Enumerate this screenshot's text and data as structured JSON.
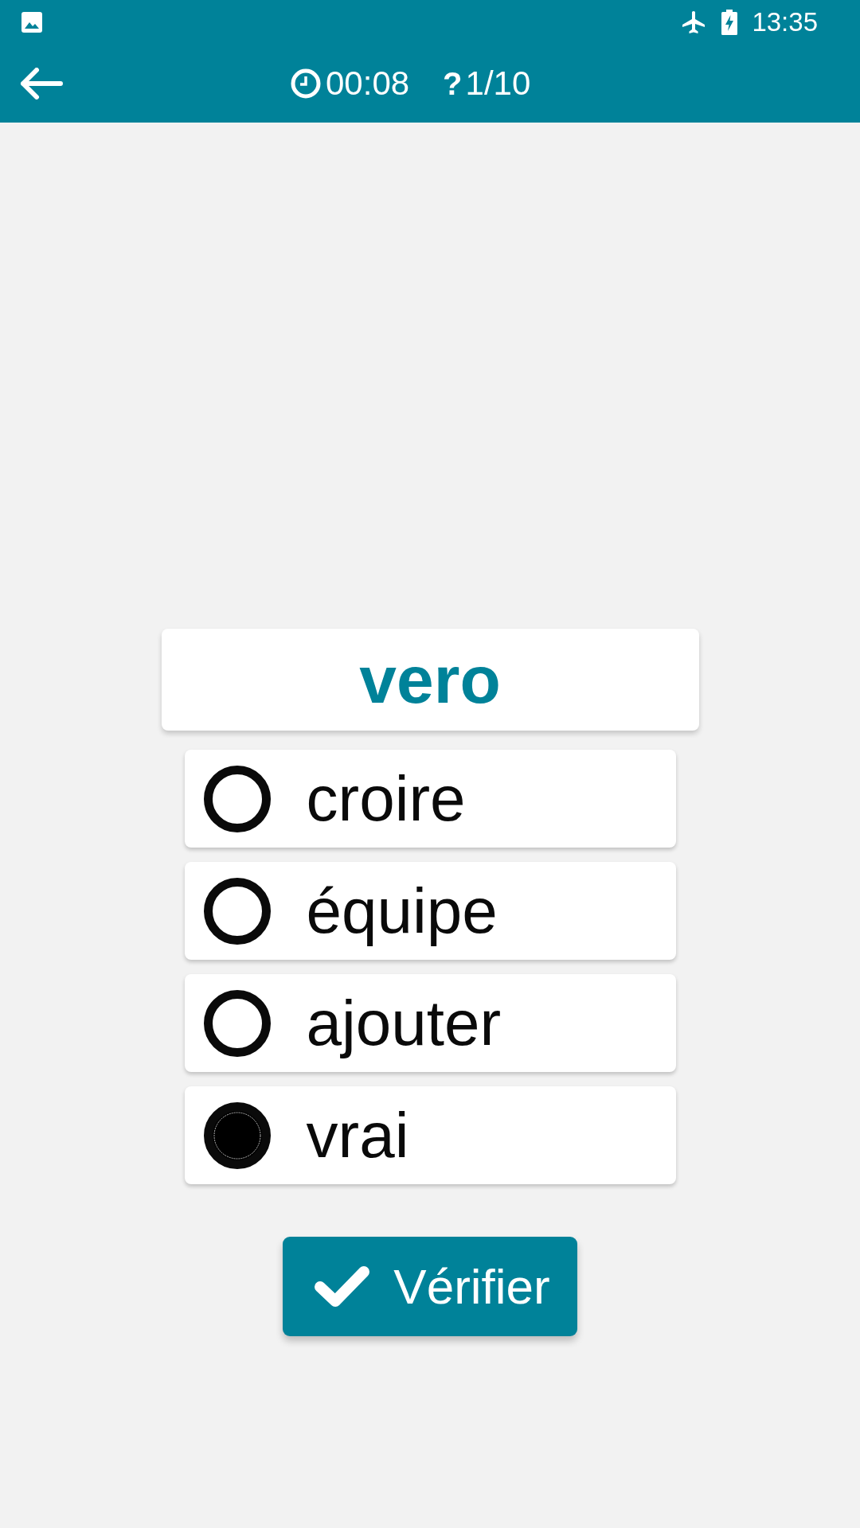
{
  "status_bar": {
    "time": "13:35"
  },
  "toolbar": {
    "timer": "00:08",
    "question_mark": "?",
    "progress": "1/10"
  },
  "word": "vero",
  "options": [
    {
      "label": "croire",
      "selected": false
    },
    {
      "label": "équipe",
      "selected": false
    },
    {
      "label": "ajouter",
      "selected": false
    },
    {
      "label": "vrai",
      "selected": true
    }
  ],
  "verify_button": {
    "label": "Vérifier"
  }
}
